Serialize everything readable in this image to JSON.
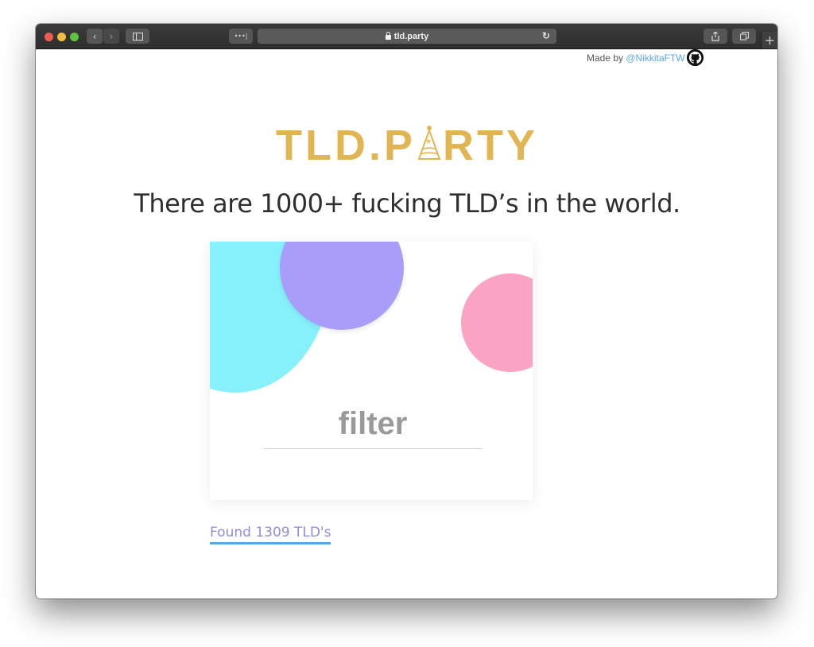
{
  "browser": {
    "url": "tld.party",
    "tab_dots": "•••|",
    "new_tab": "+"
  },
  "header": {
    "made_by_prefix": "Made by",
    "author_handle": "@NikkitaFTW",
    "github_icon": "github-icon"
  },
  "hero": {
    "logo_left": "TLD.P",
    "logo_right": "RTY",
    "logo_icon": "party-hat-icon",
    "tagline": "There are 1000+ fucking TLD’s in the world."
  },
  "search": {
    "placeholder": "filter",
    "value": ""
  },
  "results": {
    "found_text": "Found 1309 TLD's"
  },
  "colors": {
    "logo": "#e2b553",
    "cyan": "#86f1fb",
    "purple": "#a89df9",
    "pink": "#fba3c2",
    "link": "#5aa7e8",
    "found": "#8f8de0"
  }
}
